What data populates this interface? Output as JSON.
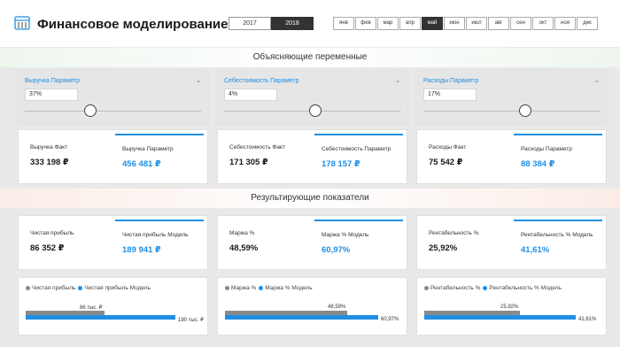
{
  "header": {
    "title": "Финансовое моделирование",
    "years": [
      "2017",
      "2018"
    ],
    "active_year": "2018",
    "months": [
      "янв",
      "фев",
      "мар",
      "апр",
      "май",
      "июн",
      "июл",
      "авг",
      "сен",
      "окт",
      "ноя",
      "дек"
    ],
    "active_month": "май"
  },
  "sections": {
    "explanatory": "Объясняющие переменные",
    "results": "Результирующие показатели"
  },
  "params": [
    {
      "title": "Выручка Параметр",
      "value": "37%",
      "slider_fraction": 0.37
    },
    {
      "title": "Себестоимость Параметр",
      "value": "4%",
      "slider_fraction": 0.52
    },
    {
      "title": "Расходы Параметр",
      "value": "17%",
      "slider_fraction": 0.58
    }
  ],
  "inputs_cards": [
    {
      "fact_label": "Выручка Факт",
      "fact_value": "333 198 ₽",
      "model_label": "Выручка Параметр",
      "model_value": "456 481 ₽"
    },
    {
      "fact_label": "Себестоимость Факт",
      "fact_value": "171 305 ₽",
      "model_label": "Себестоимость Параметр",
      "model_value": "178 157 ₽"
    },
    {
      "fact_label": "Расходы Факт",
      "fact_value": "75 542 ₽",
      "model_label": "Расходы Параметр",
      "model_value": "88 384 ₽"
    }
  ],
  "result_cards": [
    {
      "fact_label": "Чистая прибыль",
      "fact_value": "86 352 ₽",
      "model_label": "Чистая прибыль Модель",
      "model_value": "189 941 ₽"
    },
    {
      "fact_label": "Маржа %",
      "fact_value": "48,59%",
      "model_label": "Маржа % Модель",
      "model_value": "60,97%"
    },
    {
      "fact_label": "Рентабельность %",
      "fact_value": "25,92%",
      "model_label": "Рентабельность % Модель",
      "model_value": "41,61%"
    }
  ],
  "charts": [
    {
      "legend_a": "Чистая прибыль",
      "legend_b": "Чистая прибыль Модель",
      "label_a": "86 тыс. ₽",
      "label_b": "190 тыс. ₽",
      "fraction_a": 0.45,
      "fraction_b": 0.86
    },
    {
      "legend_a": "Маржа %",
      "legend_b": "Маржа %  Модель",
      "label_a": "48,59%",
      "label_b": "60,97%",
      "fraction_a": 0.7,
      "fraction_b": 0.88
    },
    {
      "legend_a": "Рентабельность %",
      "legend_b": "Рентабельность % Модель",
      "label_a": "25,92%",
      "label_b": "41,61%",
      "fraction_a": 0.55,
      "fraction_b": 0.87
    }
  ],
  "colors": {
    "accent": "#1f8fe5",
    "fact": "#8a8a8a",
    "dark": "#333333"
  },
  "icons": {
    "logo": "calculator-icon"
  }
}
